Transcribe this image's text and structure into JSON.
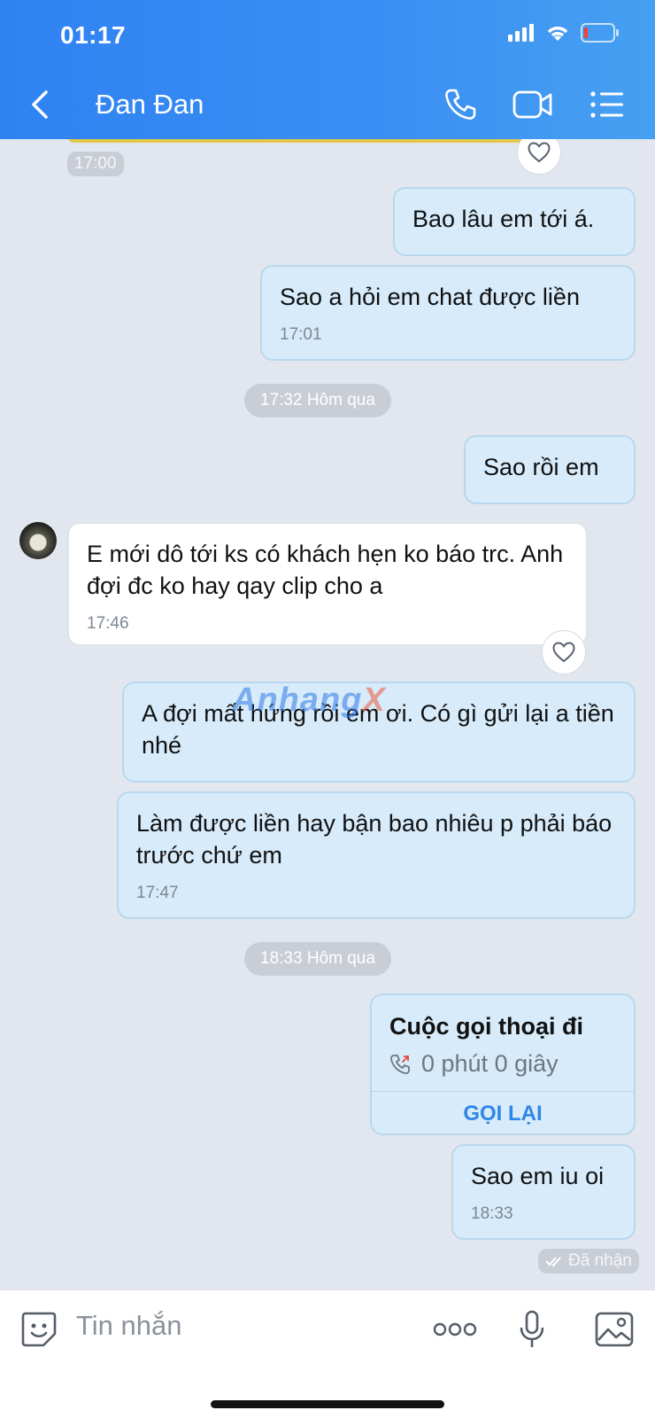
{
  "status_bar": {
    "time": "01:17"
  },
  "header": {
    "contact_name": "Đan Đan"
  },
  "colors": {
    "header_gradient_start": "#2f82f2",
    "header_gradient_end": "#46a0f1",
    "outgoing_bubble": "#d7ebfa",
    "incoming_bubble": "#ffffff",
    "accent": "#2e86e6"
  },
  "messages": [
    {
      "direction": "out",
      "text": "Bao lâu em tới á."
    },
    {
      "direction": "out",
      "text": "Sao a hỏi em chat được liền",
      "time": "17:01"
    },
    {
      "direction": "out",
      "text": "Sao rồi em"
    },
    {
      "direction": "in",
      "text": "E mới dô tới ks có khách hẹn ko báo trc. Anh đợi đc ko hay qay clip cho a",
      "time": "17:46"
    },
    {
      "direction": "out",
      "text": "A đợi mất hứng rồi em ơi. Có gì gửi lại a tiền nhé"
    },
    {
      "direction": "out",
      "text": "Làm được liền hay bận bao nhiêu p phải báo trước chứ em",
      "time": "17:47"
    },
    {
      "direction": "out",
      "text": "Sao em iu oi",
      "time": "18:33"
    }
  ],
  "timestamps": {
    "top_time": "17:00",
    "separator_1": "17:32 Hôm qua",
    "separator_2": "18:33 Hôm qua"
  },
  "call_card": {
    "title": "Cuộc gọi thoại đi",
    "duration": "0 phút 0 giây",
    "action": "GỌI LẠI"
  },
  "receipt": "Đã nhận",
  "watermark": {
    "main": "Anhang",
    "accent": "X"
  },
  "input": {
    "placeholder": "Tin nhắn"
  }
}
